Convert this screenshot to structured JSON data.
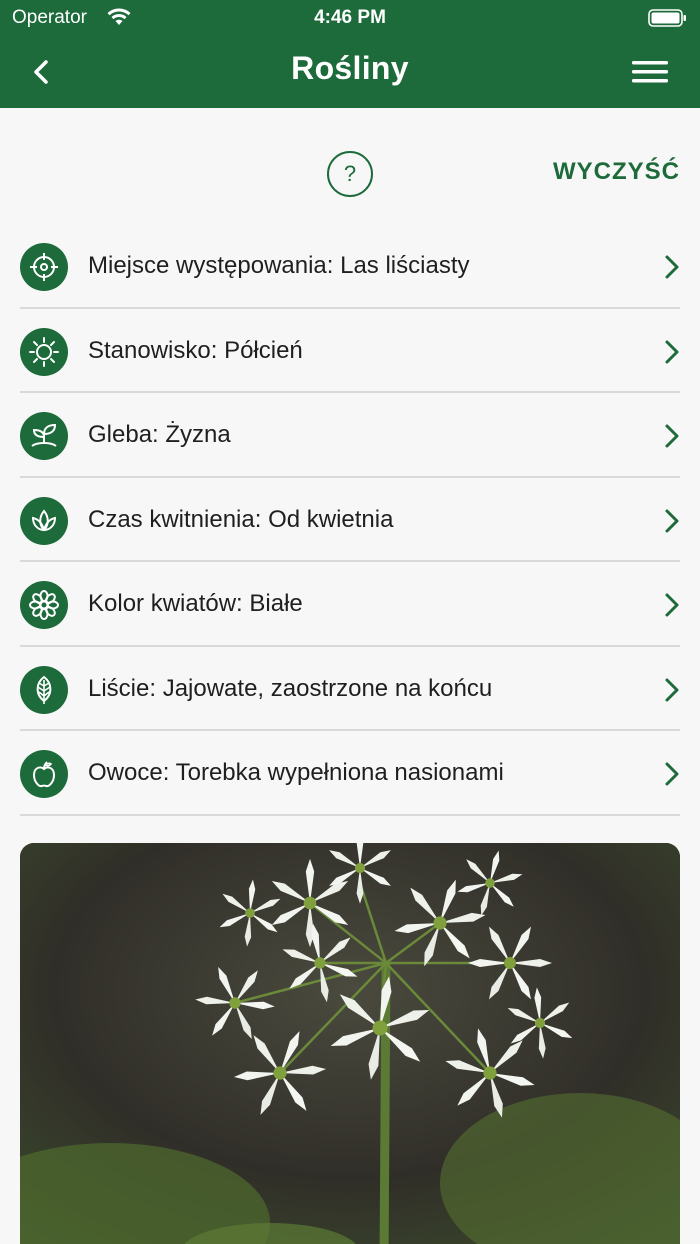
{
  "status_bar": {
    "carrier": "Operator",
    "time": "4:46 PM"
  },
  "header": {
    "title": "Rośliny"
  },
  "toolbar": {
    "help_label": "?",
    "clear_label": "WYCZYŚĆ"
  },
  "filters": [
    {
      "label": "Miejsce występowania: Las liściasty",
      "icon": "crosshair-icon"
    },
    {
      "label": "Stanowisko: Półcień",
      "icon": "sun-icon"
    },
    {
      "label": "Gleba: Żyzna",
      "icon": "sprout-icon"
    },
    {
      "label": "Czas kwitnienia: Od kwietnia",
      "icon": "lotus-icon"
    },
    {
      "label": "Kolor kwiatów: Białe",
      "icon": "flower-icon"
    },
    {
      "label": "Liście: Jajowate, zaostrzone na końcu",
      "icon": "leaf-icon"
    },
    {
      "label": "Owoce: Torebka wypełniona nasionami",
      "icon": "apple-icon"
    }
  ],
  "colors": {
    "brand_green": "#1d6a3b",
    "background": "#f7f7f7",
    "divider": "#d9d9d9"
  }
}
